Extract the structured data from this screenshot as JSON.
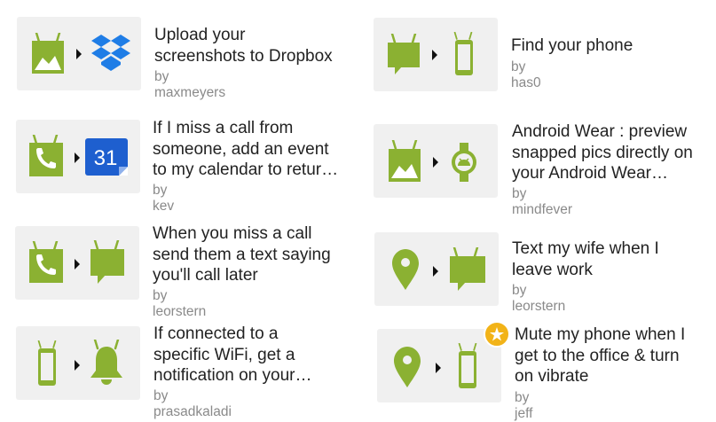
{
  "colors": {
    "android_green": "#8bb132",
    "dropbox_blue": "#1f7de6",
    "calendar_blue": "#1e5fcf",
    "title_text": "#222222",
    "byline_text": "#8a8a8a",
    "tile_bg": "#f0f0f0",
    "star_badge": "#f2b318"
  },
  "recipes": [
    {
      "title": "Upload your\nscreenshots to Dropbox",
      "byline": "by maxmeyers",
      "trigger_icon": "android-screenshot-icon",
      "action_icon": "dropbox-icon"
    },
    {
      "title": "Find your phone",
      "byline": "by has0",
      "trigger_icon": "android-sms-icon",
      "action_icon": "android-phone-icon"
    },
    {
      "title": "If I miss a call from\nsomeone, add an event\nto my calendar to retur…",
      "byline": "by kev",
      "trigger_icon": "android-phone-call-icon",
      "action_icon": "google-calendar-icon",
      "calendar_date": "31"
    },
    {
      "title": "Android Wear : preview\nsnapped pics directly on\nyour Android Wear…",
      "byline": "by mindfever",
      "trigger_icon": "android-photo-icon",
      "action_icon": "android-wear-watch-icon"
    },
    {
      "title": "When you miss a call\nsend them a text saying\nyou'll call later",
      "byline": "by leorstern",
      "trigger_icon": "android-phone-call-icon",
      "action_icon": "android-sms-icon"
    },
    {
      "title": "Text my wife when I\nleave work",
      "byline": "by leorstern",
      "trigger_icon": "android-location-icon",
      "action_icon": "android-sms-icon"
    },
    {
      "title": "If connected to a\nspecific WiFi, get a\nnotification on your…",
      "byline": "by prasadkaladi",
      "trigger_icon": "android-device-icon",
      "action_icon": "android-notification-bell-icon"
    },
    {
      "title": "Mute my phone when I\nget to the office & turn\non vibrate",
      "byline": "by jeff",
      "trigger_icon": "android-location-icon",
      "action_icon": "android-device-icon",
      "featured": true,
      "badge_icon": "star-icon"
    }
  ]
}
